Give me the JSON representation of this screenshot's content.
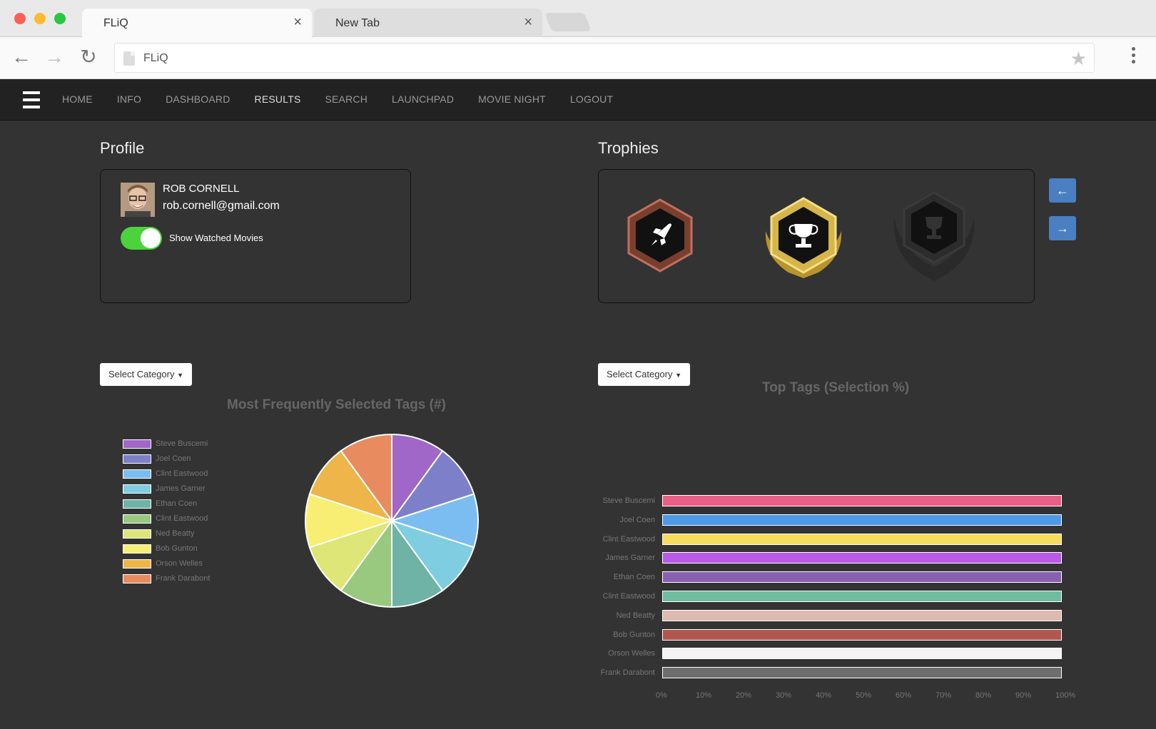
{
  "browser": {
    "tabs": [
      {
        "title": "FLiQ",
        "close": "×"
      },
      {
        "title": "New Tab",
        "close": "×"
      }
    ],
    "url": "FLiQ"
  },
  "nav": {
    "items": [
      "HOME",
      "INFO",
      "DASHBOARD",
      "RESULTS",
      "SEARCH",
      "LAUNCHPAD",
      "MOVIE NIGHT",
      "LOGOUT"
    ],
    "active": "RESULTS"
  },
  "profile": {
    "section_title": "Profile",
    "name": "ROB CORNELL",
    "email": "rob.cornell@gmail.com",
    "toggle_label": "Show Watched Movies",
    "toggle_on": true
  },
  "trophies": {
    "section_title": "Trophies",
    "items": [
      {
        "icon": "rocket-icon",
        "tier": "bronze"
      },
      {
        "icon": "trophy-icon",
        "tier": "gold"
      },
      {
        "icon": "trophy-icon",
        "tier": "locked"
      }
    ],
    "prev_label": "←",
    "next_label": "→"
  },
  "controls": {
    "select_left": "Select Category",
    "select_right": "Select Category"
  },
  "colors": {
    "pie": [
      "#a066c8",
      "#7d80c9",
      "#7bbdf0",
      "#7fcde0",
      "#6fb3a6",
      "#98c97e",
      "#dde677",
      "#f8ee73",
      "#eeb54a",
      "#e88b5e"
    ],
    "bars": [
      "#e95e87",
      "#4c9ae8",
      "#f6dd5b",
      "#b85ae8",
      "#8860b0",
      "#6fbca0",
      "#dcbaaf",
      "#b25750",
      "#f4f4f4",
      "#6e6e6e"
    ]
  },
  "chart_data": [
    {
      "type": "pie",
      "title": "Most Frequently Selected Tags (#)",
      "categories": [
        "Steve Buscemi",
        "Joel Coen",
        "Clint Eastwood",
        "James Garner",
        "Ethan Coen",
        "Clint Eastwood",
        "Ned Beatty",
        "Bob Gunton",
        "Orson Welles",
        "Frank Darabont"
      ],
      "values": [
        1,
        1,
        1,
        1,
        1,
        1,
        1,
        1,
        1,
        1
      ],
      "legend": "left"
    },
    {
      "type": "bar",
      "orientation": "horizontal",
      "title": "Top Tags (Selection %)",
      "categories": [
        "Steve Buscemi",
        "Joel Coen",
        "Clint Eastwood",
        "James Garner",
        "Ethan Coen",
        "Clint Eastwood",
        "Ned Beatty",
        "Bob Gunton",
        "Orson Welles",
        "Frank Darabont"
      ],
      "values": [
        100,
        100,
        100,
        100,
        100,
        100,
        100,
        100,
        100,
        100
      ],
      "xlim": [
        0,
        100
      ],
      "xticks": [
        "0%",
        "10%",
        "20%",
        "30%",
        "40%",
        "50%",
        "60%",
        "70%",
        "80%",
        "90%",
        "100%"
      ],
      "grid": false
    }
  ]
}
